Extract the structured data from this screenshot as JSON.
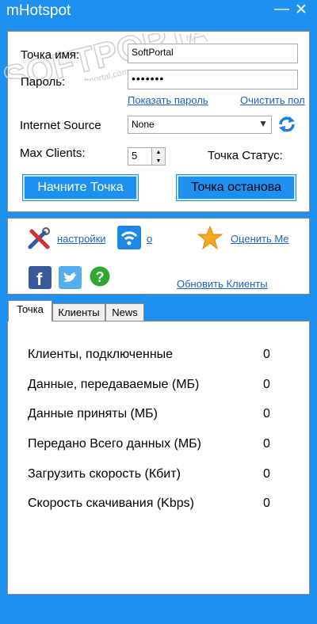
{
  "app": {
    "title": "mHotspot"
  },
  "window": {
    "minimize": "—",
    "close": "✕"
  },
  "form": {
    "hotspot_name_label": "Точка имя:",
    "hotspot_name_value": "SoftPortal",
    "password_label": "Пароль:",
    "password_value": "•••••••",
    "show_password": "Показать пароль",
    "clear_password": "Очистить пол",
    "internet_source_label": "Internet Source",
    "internet_source_value": "None",
    "max_clients_label": "Max Clients:",
    "max_clients_value": "5",
    "status_label": "Точка Статус:",
    "start_button": "Начните Точка",
    "stop_button": "Точка останова"
  },
  "watermark": {
    "text": "SOFTPORTAL",
    "url": "www.softportal.com",
    "tm": "TM"
  },
  "links": {
    "settings": "настройки",
    "about": "о",
    "rate_me": "Оценить Me",
    "refresh_clients": "Обновить Клиенты"
  },
  "tabs": [
    "Точка",
    "Клиенты",
    "News"
  ],
  "stats": [
    {
      "label": "Клиенты, подключенные",
      "value": "0"
    },
    {
      "label": "Данные, передаваемые (МБ)",
      "value": "0"
    },
    {
      "label": "Данные приняты (МБ)",
      "value": "0"
    },
    {
      "label": "Передано Всего данных (МБ)",
      "value": "0"
    },
    {
      "label": "Загрузить скорость (Кбит)",
      "value": "0"
    },
    {
      "label": "Скорость скачивания (Kbps)",
      "value": "0"
    }
  ],
  "colors": {
    "accent": "#1e90f0",
    "link": "#1a63c9"
  }
}
